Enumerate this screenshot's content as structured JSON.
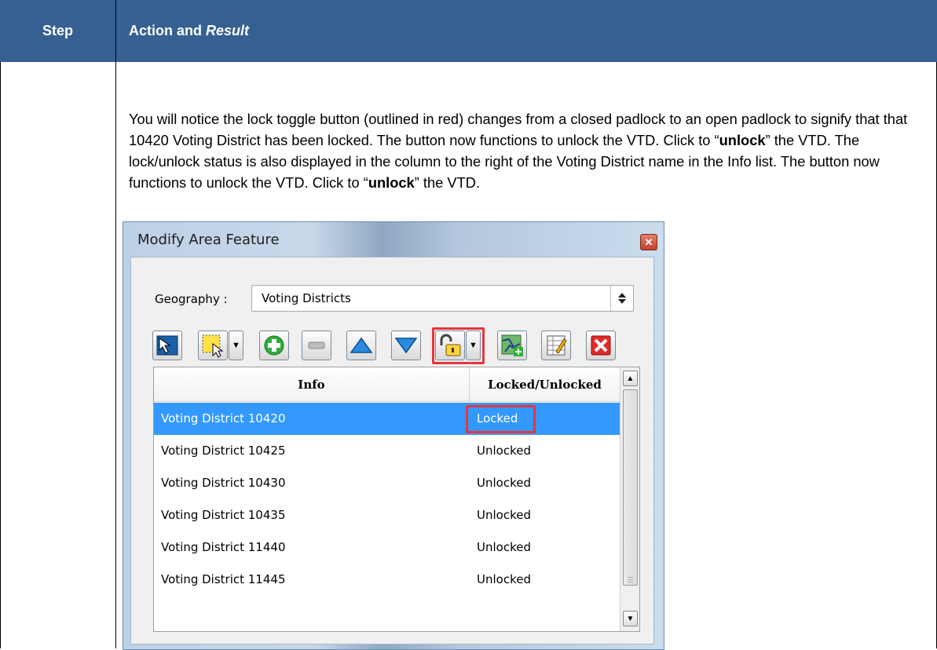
{
  "table": {
    "header_step": "Step",
    "header_action": "Action and",
    "header_result": "Result"
  },
  "instructions": {
    "p1": "You will notice the lock toggle button (outlined in red) changes from a closed padlock to an open padlock to signify that that 10420 Voting District has been locked. The button now functions to unlock the VTD. Click to “",
    "b1": "unlock",
    "p2": "” the VTD. The lock/unlock status is also displayed in the column to the right of the Voting District name in the Info list. The button now functions to unlock the VTD. Click to “",
    "b2": "unlock",
    "p3": "” the VTD."
  },
  "dialog": {
    "title": "Modify Area Feature",
    "close_glyph": "✕",
    "geography_label": "Geography :",
    "geography_value": "Voting Districts",
    "toolbar_icons": [
      "select-feature-icon",
      "rectangle-select-icon",
      "add-icon",
      "remove-icon",
      "move-up-icon",
      "move-down-icon",
      "open-padlock-icon",
      "map-add-icon",
      "edit-table-icon",
      "delete-icon"
    ],
    "list": {
      "col_info": "Info",
      "col_locked": "Locked/Unlocked",
      "rows": [
        {
          "name": "Voting District 10420",
          "status": "Locked",
          "selected": true
        },
        {
          "name": "Voting District 10425",
          "status": "Unlocked",
          "selected": false
        },
        {
          "name": "Voting District 10430",
          "status": "Unlocked",
          "selected": false
        },
        {
          "name": "Voting District 10435",
          "status": "Unlocked",
          "selected": false
        },
        {
          "name": "Voting District 11440",
          "status": "Unlocked",
          "selected": false
        },
        {
          "name": "Voting District 11445",
          "status": "Unlocked",
          "selected": false
        }
      ]
    }
  },
  "colors": {
    "header_bg": "#366092",
    "selection": "#3399ff",
    "highlight_outline": "#e8353d"
  }
}
